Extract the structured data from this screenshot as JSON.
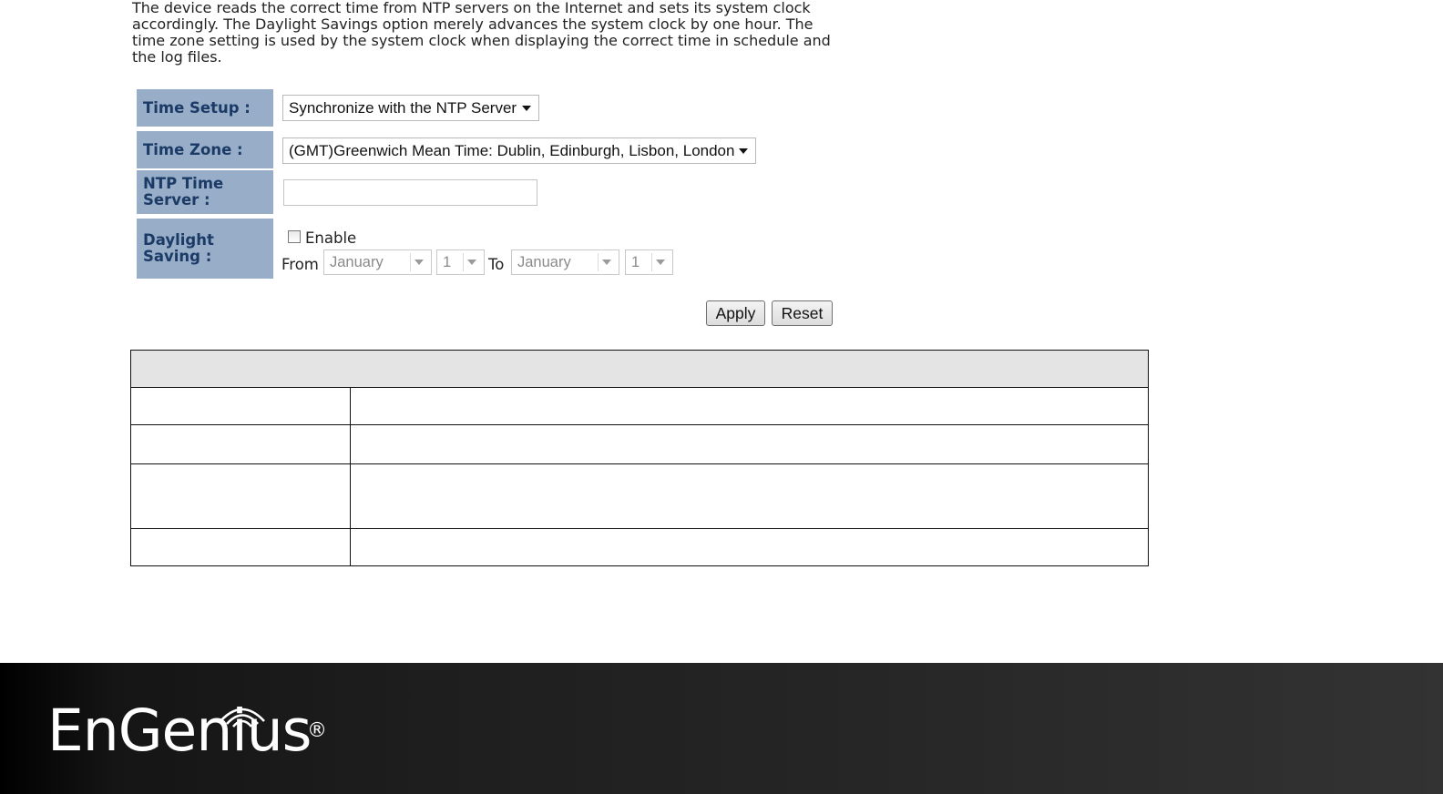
{
  "intro": {
    "line1": "The device reads the correct time from NTP servers on the Internet and sets its system clock",
    "line2": "accordingly. The Daylight Savings option merely advances the system clock by one hour. The",
    "line3": "time zone setting is used by the system clock when displaying the correct time in schedule and",
    "line4": "the log files."
  },
  "form": {
    "time_setup": {
      "label": "Time Setup :",
      "value": "Synchronize with the NTP Server"
    },
    "time_zone": {
      "label": "Time Zone :",
      "value": "(GMT)Greenwich Mean Time: Dublin, Edinburgh, Lisbon, London"
    },
    "ntp_server": {
      "label_line1": "NTP Time",
      "label_line2": "Server :",
      "value": ""
    },
    "daylight": {
      "label_line1": "Daylight",
      "label_line2": "Saving :",
      "enable_label": "Enable",
      "enabled": false,
      "from_label": "From",
      "from_month": "January",
      "from_day": "1",
      "to_label": "To",
      "to_month": "January",
      "to_day": "1"
    }
  },
  "buttons": {
    "apply": "Apply",
    "reset": "Reset"
  },
  "footer": {
    "brand": "EnGenius",
    "registered": "®"
  },
  "colors": {
    "label_bg": "#98aec8",
    "label_text": "#1b3a66",
    "table_header_bg": "#e4e4e4",
    "footer_bg": "#1e1e1e"
  },
  "icons": {
    "footer_logo": "wifi-signal-icon",
    "dropdown": "chevron-down-icon"
  }
}
